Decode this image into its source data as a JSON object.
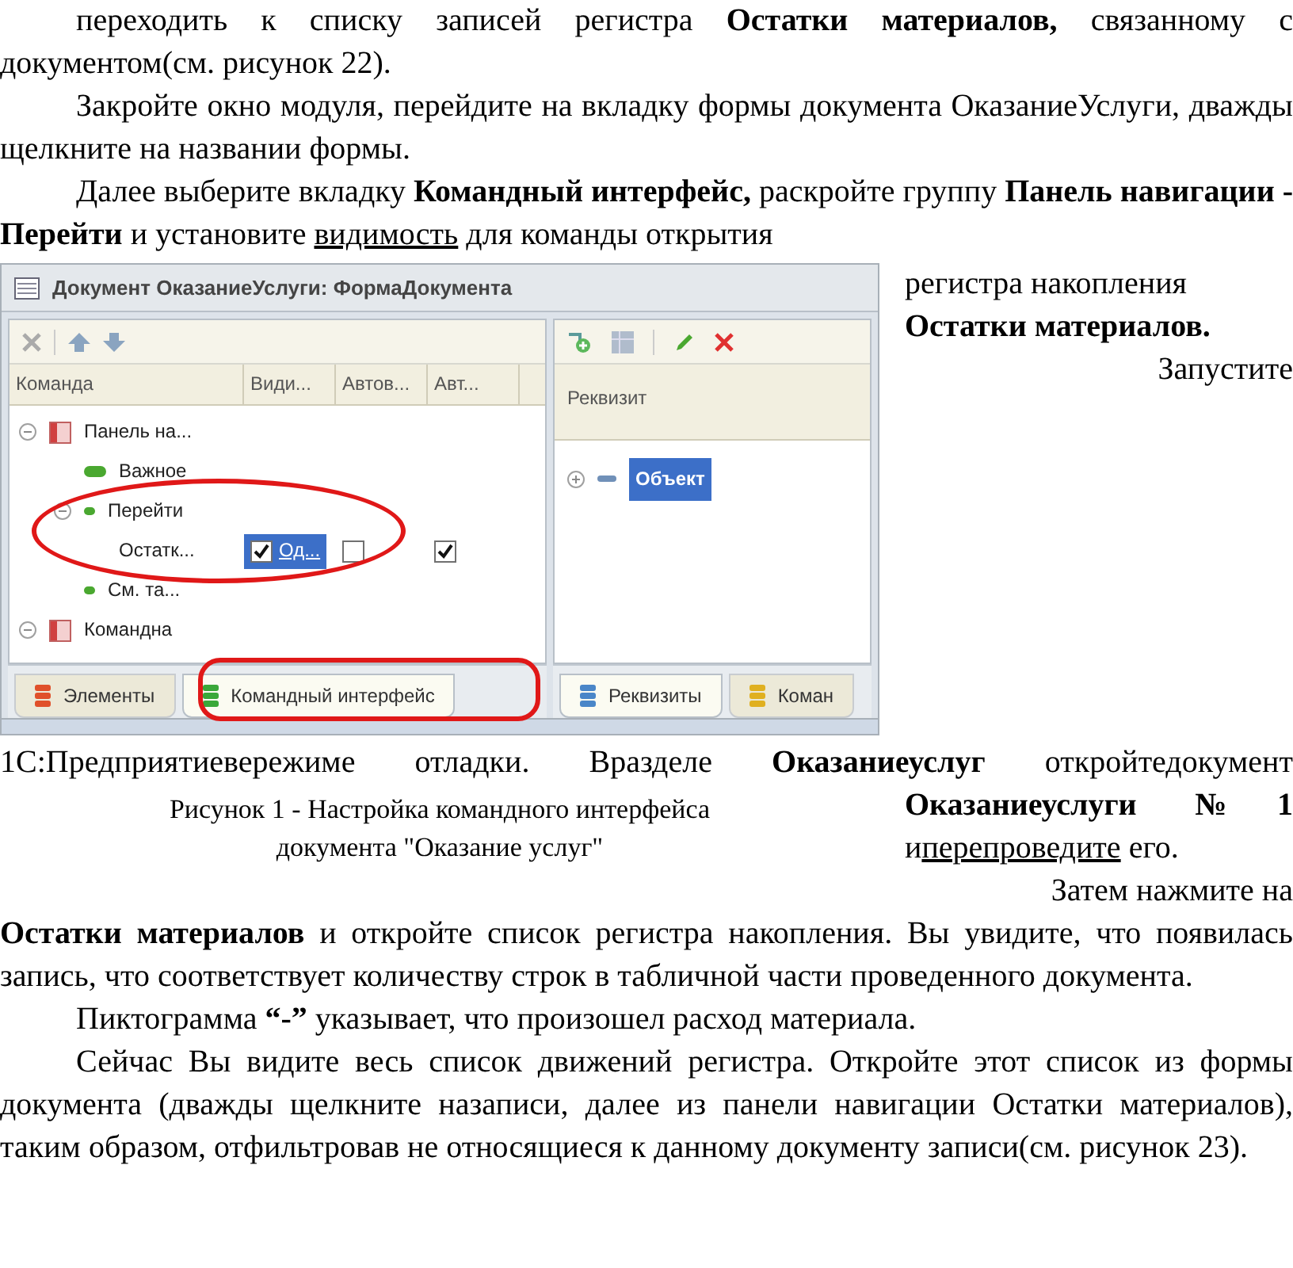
{
  "intro_paragraphs": [
    {
      "text": "переходить к списку записей регистра **Остатки материалов,** связанному с документом(см. рисунок 22)."
    },
    {
      "text": "Закройте окно модуля, перейдите на вкладку формы документа ОказаниеУслуги, дважды щелкните на названии формы."
    },
    {
      "text": "Далее выберите вкладку **Командный интерфейс,** раскройте группу **Панель навигации - Перейти** и установите ",
      "underlined": "видимость",
      "text_after": " для команды открытия"
    }
  ],
  "figure": {
    "window_title": "Документ ОказаниеУслуги: ФормаДокумента",
    "left_pane": {
      "columns": [
        "Команда",
        "Види...",
        "Автов...",
        "Авт..."
      ],
      "tree": [
        {
          "label": "Панель на...",
          "kind": "panel",
          "expanded": true,
          "children": [
            {
              "label": "Важное",
              "kind": "group"
            },
            {
              "label": "Перейти",
              "kind": "subgroup",
              "expanded": true,
              "children": [
                {
                  "label": "Остатк...",
                  "cells": [
                    {
                      "checked": true,
                      "text": "Од...",
                      "selected": true
                    },
                    {
                      "checked": false,
                      "selected": false
                    },
                    {
                      "checked": true,
                      "selected": false
                    }
                  ]
                }
              ]
            },
            {
              "label": "См. та...",
              "kind": "subgroup"
            }
          ]
        },
        {
          "label": "Командна",
          "kind": "panel",
          "expanded": true
        }
      ],
      "tabs": [
        {
          "label": "Элементы",
          "color": "#e0502a",
          "selected": false
        },
        {
          "label": "Командный интерфейс",
          "color": "#3aa83a",
          "selected": true
        }
      ]
    },
    "right_pane": {
      "column": "Реквизит",
      "tree": [
        {
          "label": "Объект",
          "selected": true,
          "expanded": false
        }
      ],
      "tabs": [
        {
          "label": "Реквизиты",
          "color": "#4a86c8",
          "selected": true
        },
        {
          "label": "Коман",
          "color": "#e0b020",
          "selected": false
        }
      ]
    },
    "caption": "Рисунок 1 - Настройка командного интерфейса документа \"Оказание услуг\""
  },
  "side_lines_1": [
    {
      "text": "регистра накопления"
    },
    {
      "text": "**Остатки материалов.**"
    },
    {
      "text": "Запустите"
    }
  ],
  "full_line": {
    "text": "1С:Предприятиевережиме отладки. Вразделе **Оказаниеуслуг** откройтедокумент"
  },
  "side_lines_2": [
    {
      "text": "**Оказаниеуслуги** **№1**"
    },
    {
      "text": "и",
      "underlined": "перепроведите",
      "text_after": " его."
    },
    {
      "text": "Затем нажмите на"
    }
  ],
  "body_paragraphs": [
    {
      "text": "**Остатки материалов** и откройте список регистра накопления. Вы увидите, что появилась запись, что соответствует количеству строк в табличной части проведенного документа."
    },
    {
      "text": "Пиктограмма **“-”** указывает, что произошел расход материала."
    },
    {
      "text": "Сейчас Вы видите весь список движений регистра. Откройте этот список из формы документа (дважды щелкните назаписи, далее из панели навигации Остатки материалов), таким образом, отфильтровав не относящиеся к данному документу записи(см. рисунок 23)."
    }
  ]
}
